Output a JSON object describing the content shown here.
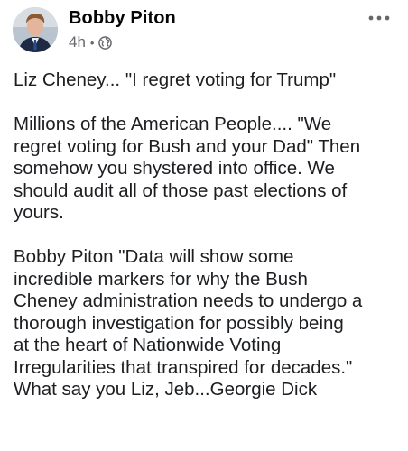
{
  "post": {
    "author": "Bobby Piton",
    "time": "4h",
    "separator": "•",
    "audience_icon": "globe-icon",
    "more_icon": "more-horizontal-icon",
    "paragraphs": [
      [
        "Liz Cheney...  \"I regret voting for Trump\""
      ],
      [
        "Millions of the American People.... \"We",
        "regret voting for Bush and your Dad\" Then",
        "somehow you shystered into office.  We",
        "should audit all of those past elections of",
        "yours."
      ],
      [
        "Bobby Piton \"Data will show some",
        "incredible markers for why the Bush",
        "Cheney administration needs to undergo a",
        "thorough investigation for possibly being",
        "at the heart of Nationwide Voting",
        "Irregularities that transpired for decades.\"",
        "What say you Liz, Jeb...Georgie Dick"
      ]
    ]
  },
  "colors": {
    "text": "#1c1e21",
    "meta": "#65676b",
    "background": "#ffffff"
  }
}
